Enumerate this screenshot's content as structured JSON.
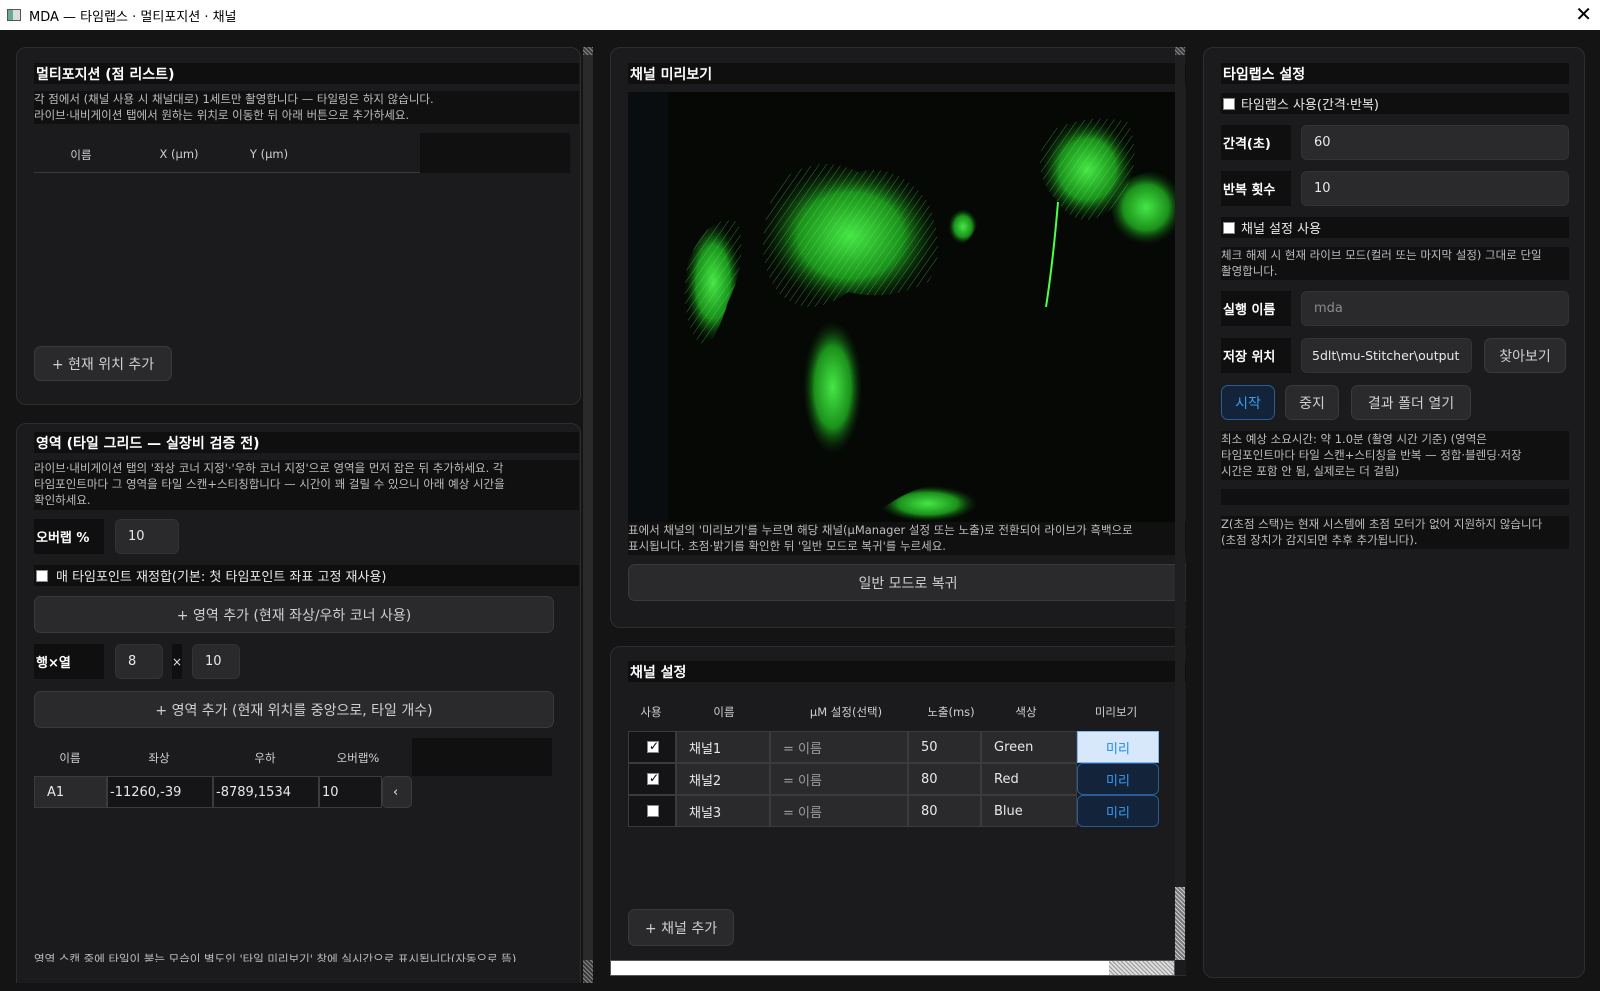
{
  "window": {
    "title": "MDA — 타임랩스 · 멀티포지션 · 채널",
    "close": "✕"
  },
  "multipos": {
    "title": "멀티포지션 (점 리스트)",
    "note_line1": "각 점에서 (채널 사용 시 채널대로) 1세트만 촬영합니다 — 타일링은 하지 않습니다.",
    "note_line2": "라이브·내비게이션 탭에서 원하는 위치로 이동한 뒤 아래 버튼으로 추가하세요.",
    "columns": [
      "이름",
      "X (µm)",
      "Y (µm)"
    ],
    "add_button": "+ 현재 위치 추가"
  },
  "region": {
    "title": "영역 (타일 그리드 — 실장비 검증 전)",
    "note_line1": "라이브·내비게이션 탭의 '좌상 코너 지정'·'우하 코너 지정'으로 영역을 먼저 잡은 뒤 추가하세요. 각",
    "note_line2": "타임포인트마다 그 영역을 타일 스캔+스티칭합니다 — 시간이 꽤 걸릴 수 있으니 아래 예상 시간을",
    "note_line3": "확인하세요.",
    "overlap_label": "오버랩 %",
    "overlap_value": "10",
    "realign_label": "매 타임포인트 재정합(기본: 첫 타임포인트 좌표 고정 재사용)",
    "add_corner_button": "+ 영역 추가 (현재 좌상/우하 코너 사용)",
    "rowcol_label": "행×열",
    "rows": "8",
    "times": "×",
    "cols": "10",
    "add_center_button": "+ 영역 추가 (현재 위치를 중앙으로, 타일 개수)",
    "columns": [
      "이름",
      "좌상",
      "우하",
      "오버랩%"
    ],
    "rows_data": [
      {
        "name": "A1",
        "tl": "-11260,-39",
        "br": "-8789,1534",
        "overlap": "10",
        "action": "‹"
      }
    ],
    "bottom_note": "영역 스캔 중에 타일이 붙는 모습이 별도인 '타일 미리보기' 창에 실시간으로 표시됩니다(자동으로 뜸)"
  },
  "preview": {
    "title": "채널 미리보기",
    "note_line1": "표에서 채널의 '미리보기'를 누르면 해당 채널(µManager 설정 또는 노출)로 전환되어 라이브가 흑백으로",
    "note_line2": "표시됩니다. 초점·밝기를 확인한 뒤 '일반 모드로 복귀'를 누르세요.",
    "restore_button": "일반 모드로 복귀"
  },
  "channels": {
    "title": "채널 설정",
    "columns": [
      "사용",
      "이름",
      "µM 설정(선택)",
      "노출(ms)",
      "색상",
      "미리보기"
    ],
    "rows": [
      {
        "use": true,
        "name": "채널1",
        "config": "= 이름",
        "exposure": "50",
        "color": "Green",
        "preview": "미리"
      },
      {
        "use": true,
        "name": "채널2",
        "config": "= 이름",
        "exposure": "80",
        "color": "Red",
        "preview": "미리"
      },
      {
        "use": false,
        "name": "채널3",
        "config": "= 이름",
        "exposure": "80",
        "color": "Blue",
        "preview": "미리"
      }
    ],
    "add_button": "+ 채널 추가"
  },
  "timelapse": {
    "title": "타임랩스 설정",
    "use_label": "타임랩스 사용(간격·반복)",
    "interval_label": "간격(초)",
    "interval_value": "60",
    "repeat_label": "반복 횟수",
    "repeat_value": "10",
    "channel_use_label": "채널 설정 사용",
    "channel_note_line1": "체크 해제 시 현재 라이브 모드(컬러 또는 마지막 설정) 그대로 단일",
    "channel_note_line2": "촬영합니다.",
    "run_name_label": "실행 이름",
    "run_name_placeholder": "mda",
    "save_label": "저장 위치",
    "save_value": "5dlt\\mu-Stitcher\\output",
    "browse_button": "찾아보기",
    "start_button": "시작",
    "stop_button": "중지",
    "open_folder_button": "결과 폴더 열기",
    "estimate_line1": "최소 예상 소요시간: 약 1.0분 (촬영 시간 기준) (영역은",
    "estimate_line2": "타임포인트마다 타일 스캔+스티칭을 반복 — 정합·블렌딩·저장",
    "estimate_line3": "시간은 포함 안 됨, 실제로는 더 걸림)",
    "z_note_line1": "Z(초점 스택)는 현재 시스템에 초점 모터가 없어 지원하지 않습니다",
    "z_note_line2": "(초점 장치가 감지되면 추후 추가됩니다)."
  },
  "colors": {
    "accent": "#1e88e5",
    "cell_green": "#2fbf3a",
    "background": "#141414"
  }
}
